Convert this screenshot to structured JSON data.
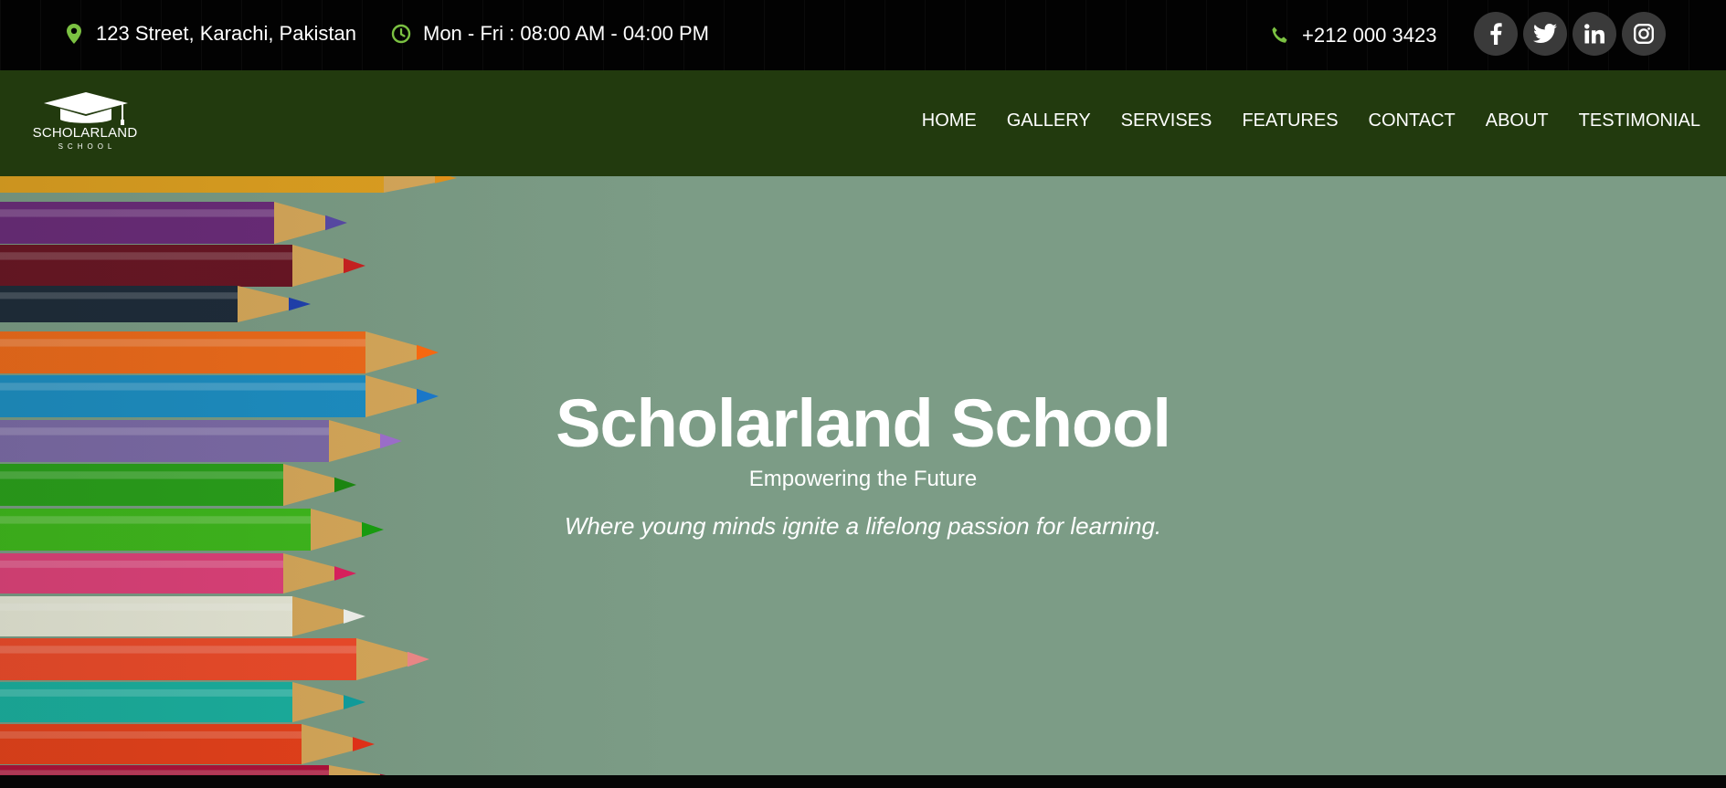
{
  "topbar": {
    "address": "123 Street, Karachi, Pakistan",
    "hours": "Mon - Fri : 08:00 AM - 04:00 PM",
    "phone": "+212 000 3423",
    "icon_color": "#7bc142",
    "icons": {
      "address": "map-marker-icon",
      "hours": "clock-icon",
      "phone": "phone-icon"
    },
    "socials": [
      {
        "name": "facebook",
        "icon": "facebook-icon"
      },
      {
        "name": "twitter",
        "icon": "twitter-icon"
      },
      {
        "name": "linkedin",
        "icon": "linkedin-icon"
      },
      {
        "name": "instagram",
        "icon": "instagram-icon"
      }
    ]
  },
  "navbar": {
    "background": "#223a0e",
    "logo": {
      "name": "SCHOLARLAND",
      "sub": "SCHOOL",
      "icon": "graduation-cap-icon"
    },
    "links": [
      "HOME",
      "GALLERY",
      "SERVISES",
      "FEATURES",
      "CONTACT",
      "ABOUT",
      "TESTIMONIAL"
    ]
  },
  "hero": {
    "title": "Scholarland School",
    "subtitle": "Empowering the Future",
    "tagline": "Where young minds ignite a lifelong passion for learning.",
    "background": "#7c9c86",
    "image": "colored-pencils-image"
  }
}
